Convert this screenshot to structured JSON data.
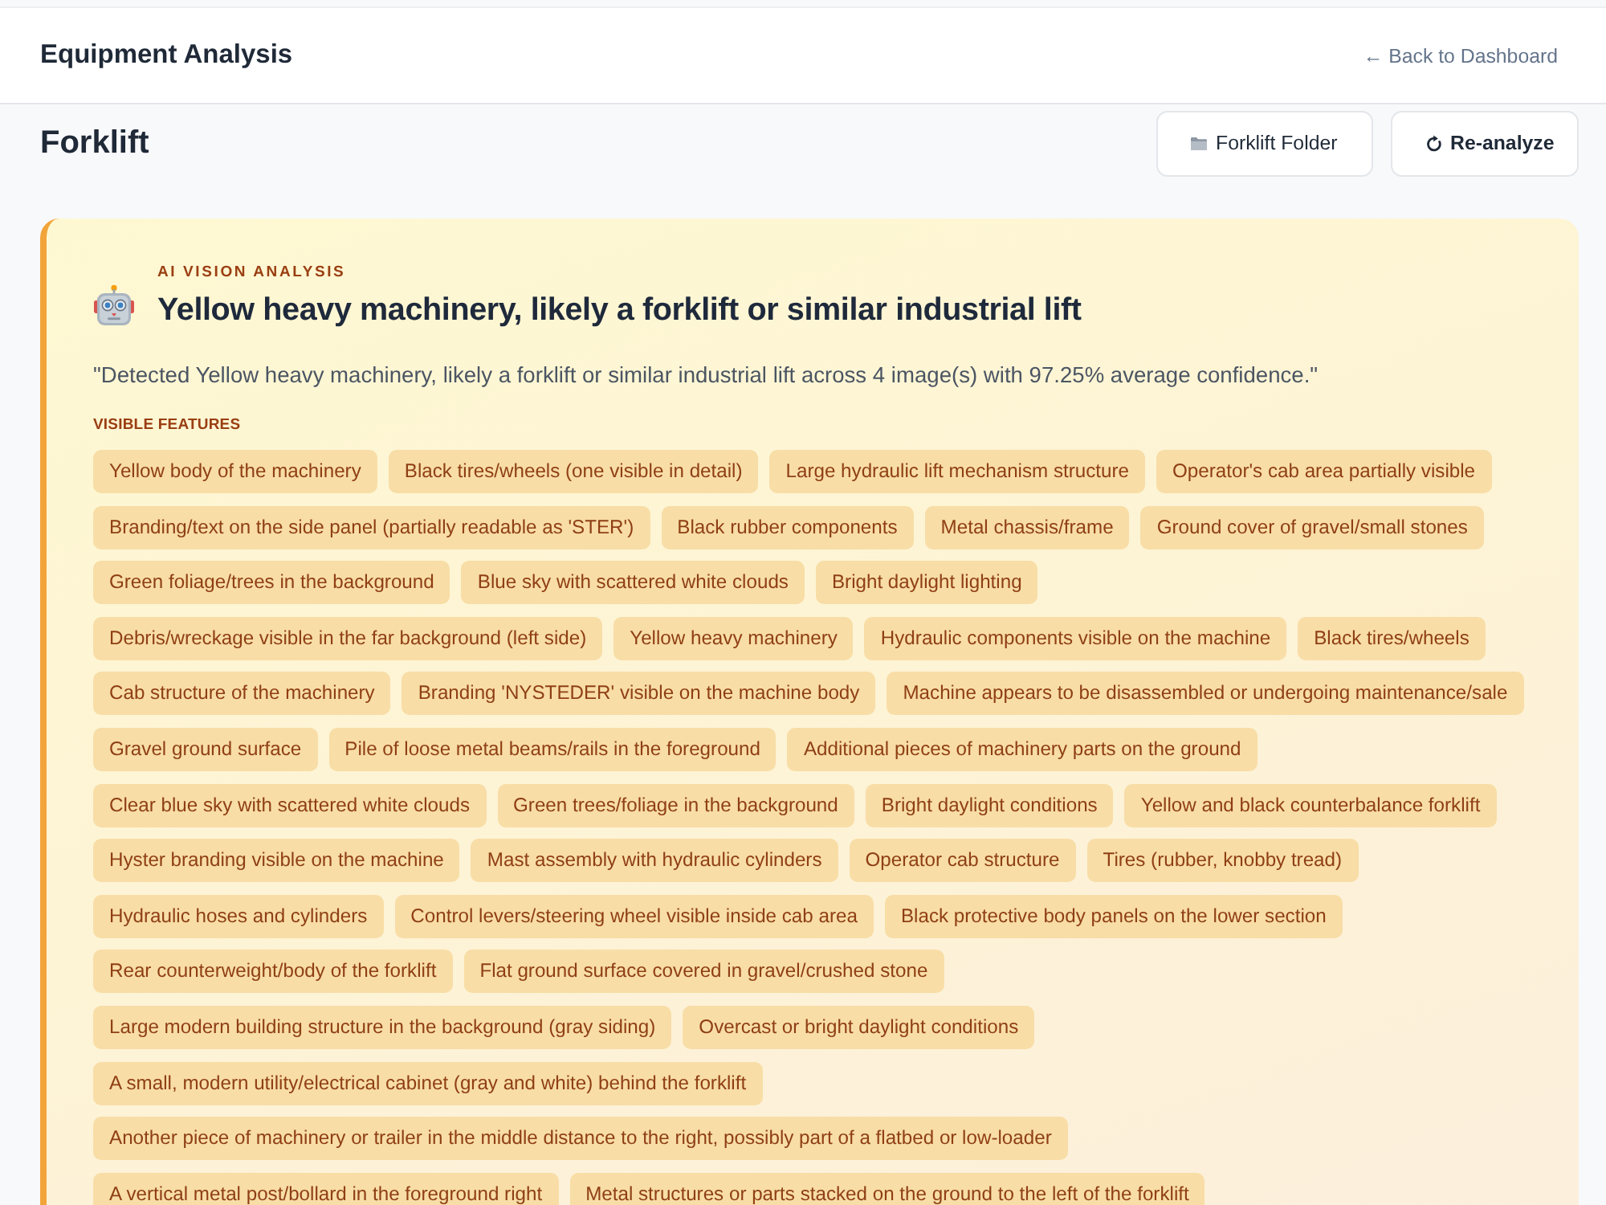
{
  "header": {
    "title": "Equipment Analysis",
    "back_link": "← Back to Dashboard"
  },
  "page": {
    "title": "Forklift",
    "actions": [
      {
        "label": "Forklift Folder",
        "kind": "folder"
      },
      {
        "label": "Re-analyze",
        "kind": "refresh"
      }
    ]
  },
  "analysis": {
    "eyebrow": "AI VISION ANALYSIS",
    "title": "Yellow heavy machinery, likely a forklift or similar industrial lift",
    "summary": "\"Detected Yellow heavy machinery, likely a forklift or similar industrial lift across 4 image(s) with 97.25% average confidence.\"",
    "features_label": "VISIBLE FEATURES",
    "features": [
      "Yellow body of the machinery",
      "Black tires/wheels (one visible in detail)",
      "Large hydraulic lift mechanism structure",
      "Operator's cab area partially visible",
      "Branding/text on the side panel (partially readable as 'STER')",
      "Black rubber components",
      "Metal chassis/frame",
      "Ground cover of gravel/small stones",
      "Green foliage/trees in the background",
      "Blue sky with scattered white clouds",
      "Bright daylight lighting",
      "Debris/wreckage visible in the far background (left side)",
      "Yellow heavy machinery",
      "Hydraulic components visible on the machine",
      "Black tires/wheels",
      "Cab structure of the machinery",
      "Branding 'NYSTEDER' visible on the machine body",
      "Machine appears to be disassembled or undergoing maintenance/sale",
      "Gravel ground surface",
      "Pile of loose metal beams/rails in the foreground",
      "Additional pieces of machinery parts on the ground",
      "Clear blue sky with scattered white clouds",
      "Green trees/foliage in the background",
      "Bright daylight conditions",
      "Yellow and black counterbalance forklift",
      "Hyster branding visible on the machine",
      "Mast assembly with hydraulic cylinders",
      "Operator cab structure",
      "Tires (rubber, knobby tread)",
      "Hydraulic hoses and cylinders",
      "Control levers/steering wheel visible inside cab area",
      "Black protective body panels on the lower section",
      "Rear counterweight/body of the forklift",
      "Flat ground surface covered in gravel/crushed stone",
      "Large modern building structure in the background (gray siding)",
      "Overcast or bright daylight conditions",
      "A small, modern utility/electrical cabinet (gray and white) behind the forklift",
      "Another piece of machinery or trailer in the middle distance to the right, possibly part of a flatbed or low-loader",
      "A vertical metal post/bollard in the foreground right",
      "Metal structures or parts stacked on the ground to the left of the forklift"
    ]
  }
}
